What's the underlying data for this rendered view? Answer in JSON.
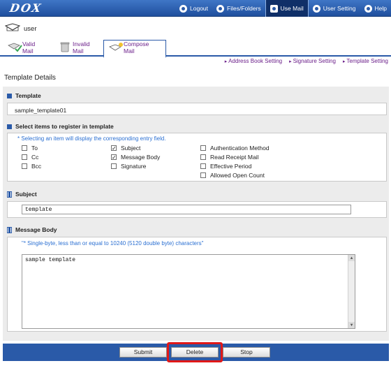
{
  "header": {
    "logo": "DOX",
    "nav": [
      {
        "label": "Logout",
        "icon": "logout-icon"
      },
      {
        "label": "Files/Folders",
        "icon": "files-folders-icon"
      },
      {
        "label": "Use Mail",
        "icon": "mail-icon",
        "active": true
      },
      {
        "label": "User Setting",
        "icon": "user-setting-icon"
      },
      {
        "label": "Help",
        "icon": "help-icon"
      }
    ]
  },
  "user": {
    "name": "user",
    "icon": "user-envelope-icon"
  },
  "tabs": [
    {
      "label": "Valid Mail",
      "icon": "valid-mail-icon"
    },
    {
      "label": "Invalid Mail",
      "icon": "trash-can-icon"
    },
    {
      "label": "Compose Mail",
      "icon": "compose-mail-icon",
      "active": true
    }
  ],
  "breadcrumbs": [
    "Address Book Setting",
    "Signature Setting",
    "Template Setting"
  ],
  "page_title": "Template Details",
  "template": {
    "heading": "Template",
    "value": "sample_template01"
  },
  "select_items": {
    "heading": "Select items to register in template",
    "hint": "* Selecting an item will display the corresponding entry field.",
    "columns": [
      [
        {
          "label": "To",
          "checked": false
        },
        {
          "label": "Cc",
          "checked": false
        },
        {
          "label": "Bcc",
          "checked": false
        }
      ],
      [
        {
          "label": "Subject",
          "checked": true
        },
        {
          "label": "Message Body",
          "checked": true
        },
        {
          "label": "Signature",
          "checked": false
        }
      ],
      [
        {
          "label": "Authentication Method",
          "checked": false
        },
        {
          "label": "Read Receipt Mail",
          "checked": false
        },
        {
          "label": "Effective Period",
          "checked": false
        },
        {
          "label": "Allowed Open Count",
          "checked": false
        }
      ]
    ]
  },
  "subject": {
    "heading": "Subject",
    "value": "template"
  },
  "message_body": {
    "heading": "Message Body",
    "hint": "\"* Single-byte, less than or equal to 10240 (5120 double byte) characters\"",
    "value": "sample template"
  },
  "buttons": {
    "submit": "Submit",
    "delete": "Delete",
    "stop": "Stop"
  },
  "colors": {
    "header_blue": "#2a5aa8",
    "link_purple": "#6b1f8a",
    "hint_blue": "#2a6fd2",
    "highlight_red": "#e01818"
  }
}
